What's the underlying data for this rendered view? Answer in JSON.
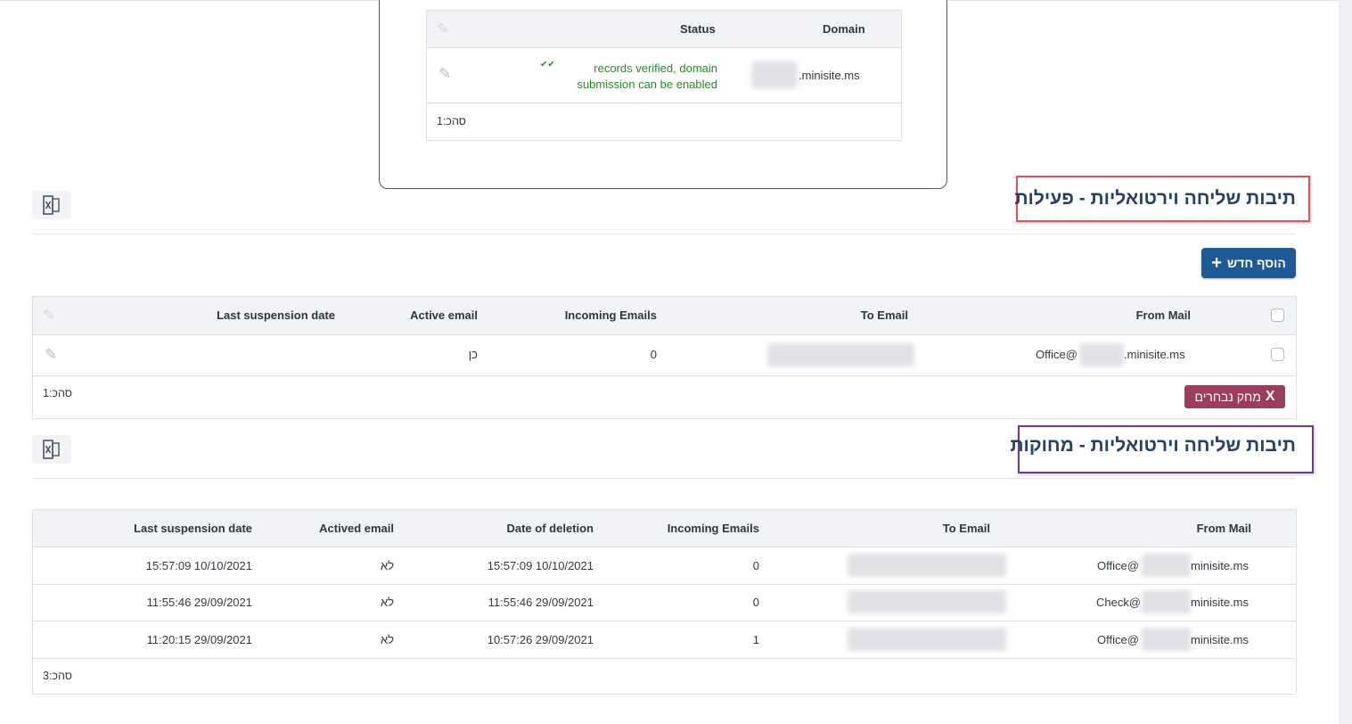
{
  "domain_table": {
    "headers": {
      "status": "Status",
      "domain": "Domain"
    },
    "row": {
      "status_text_line1": "records verified, domain",
      "status_text_line2": "submission can be enabled",
      "domain_suffix": ".minisite.ms"
    },
    "total": "סהכ:1"
  },
  "active_section": {
    "title": "תיבות שליחה וירטואליות - פעילות",
    "add_button": "הוסף חדש",
    "headers": {
      "from_mail": "From Mail",
      "to_email": "To Email",
      "incoming": "Incoming Emails",
      "active": "Active email",
      "last_suspension": "Last suspension date"
    },
    "rows": [
      {
        "from_prefix": "Office@",
        "from_suffix": ".minisite.ms",
        "incoming": "0",
        "active": "כן",
        "last_suspension": ""
      }
    ],
    "delete_button": "מחק נבחרים",
    "total": "סהכ:1"
  },
  "deleted_section": {
    "title": "תיבות שליחה וירטואליות - מחוקות",
    "headers": {
      "from_mail": "From Mail",
      "to_email": "To Email",
      "incoming": "Incoming Emails",
      "deletion": "Date of deletion",
      "actived": "Actived email",
      "last_suspension": "Last suspension date"
    },
    "rows": [
      {
        "from_prefix": "Office@",
        "from_suffix": "minisite.ms",
        "incoming": "0",
        "deletion": "15:57:09 10/10/2021",
        "actived": "לא",
        "last_suspension": "15:57:09 10/10/2021"
      },
      {
        "from_prefix": "Check@",
        "from_suffix": "minisite.ms",
        "incoming": "0",
        "deletion": "11:55:46 29/09/2021",
        "actived": "לא",
        "last_suspension": "11:55:46 29/09/2021"
      },
      {
        "from_prefix": "Office@",
        "from_suffix": "minisite.ms",
        "incoming": "1",
        "deletion": "10:57:26 29/09/2021",
        "actived": "לא",
        "last_suspension": "11:20:15 29/09/2021"
      }
    ],
    "total": "סהכ:3"
  },
  "icons": {
    "excel": "excel-export-icon",
    "edit": "pencil-icon",
    "verified": "double-check-icon",
    "plus": "plus-icon",
    "close": "x-icon"
  },
  "colors": {
    "primary": "#1e5a96",
    "danger": "#9e3d5b",
    "title": "#24416b",
    "verified": "#2a8a2a",
    "frame_active": "#e2534f",
    "frame_deleted": "#6a3b8f"
  }
}
